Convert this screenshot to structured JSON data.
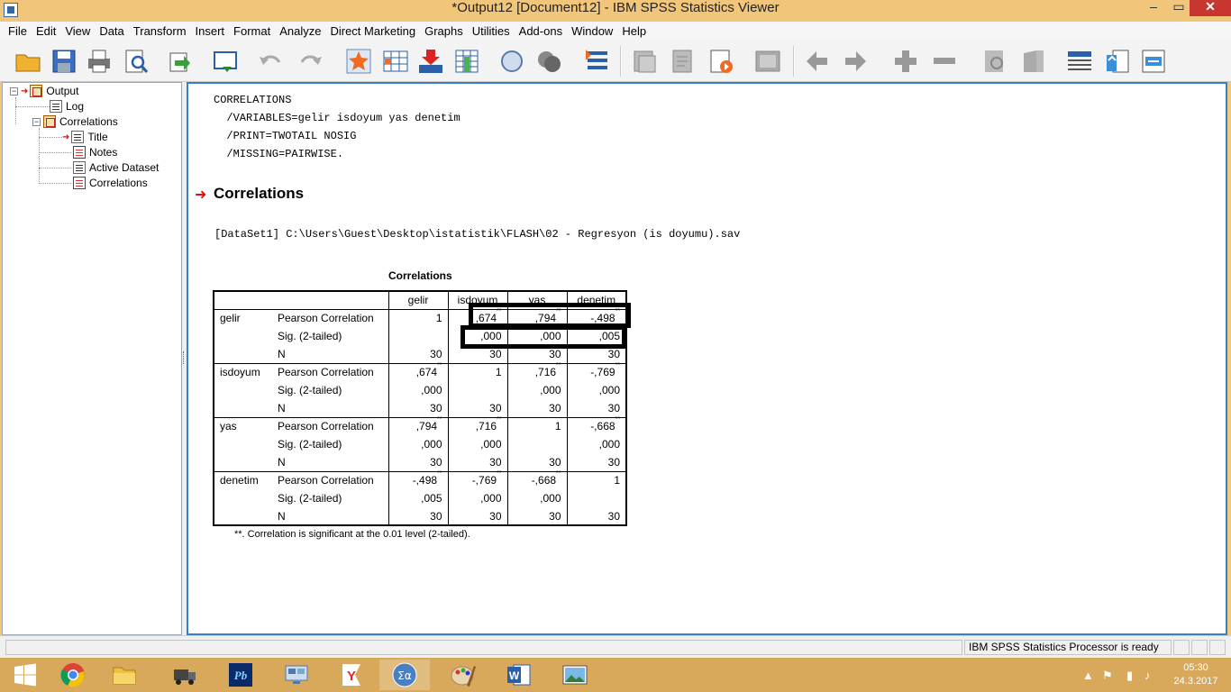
{
  "window": {
    "title": "*Output12 [Document12] - IBM SPSS Statistics Viewer",
    "minimize": "–",
    "maximize": "▭",
    "close": "✕"
  },
  "menu": [
    "File",
    "Edit",
    "View",
    "Data",
    "Transform",
    "Insert",
    "Format",
    "Analyze",
    "Direct Marketing",
    "Graphs",
    "Utilities",
    "Add-ons",
    "Window",
    "Help"
  ],
  "toolbar_icons": [
    "open-icon",
    "save-icon",
    "print-icon",
    "print-preview-icon",
    "export-icon",
    "recall-dialog-icon",
    "undo-icon",
    "redo-icon",
    "goto-data-icon",
    "goto-case-icon",
    "goto-variable-icon",
    "variables-icon",
    "designate-window-icon",
    "run-icon",
    "script-icon",
    "insert-output-icon",
    "promote-icon",
    "demote-icon",
    "expand-icon",
    "collapse-icon",
    "show-icon",
    "hide-icon",
    "insert-heading-icon",
    "insert-title-icon",
    "insert-text-icon"
  ],
  "navigator": {
    "output": "Output",
    "log": "Log",
    "correlations": "Correlations",
    "title": "Title",
    "notes": "Notes",
    "active_dataset": "Active Dataset",
    "correlations_table": "Correlations"
  },
  "content": {
    "syntax": [
      "CORRELATIONS",
      "  /VARIABLES=gelir isdoyum yas denetim",
      "  /PRINT=TWOTAIL NOSIG",
      "  /MISSING=PAIRWISE."
    ],
    "section_title": "Correlations",
    "dataset_line": "[DataSet1] C:\\Users\\Guest\\Desktop\\istatistik\\FLASH\\02 - Regresyon (is doyumu).sav",
    "table_title": "Correlations",
    "sig_mark": "**",
    "columns": [
      "gelir",
      "isdoyum",
      "yas",
      "denetim"
    ],
    "stat_labels": [
      "Pearson Correlation",
      "Sig. (2-tailed)",
      "N"
    ],
    "rows": [
      {
        "var": "gelir",
        "pearson": [
          "1",
          ",674",
          ",794",
          "-,498"
        ],
        "sig": [
          "",
          ",000",
          ",000",
          ",005"
        ],
        "n": [
          "30",
          "30",
          "30",
          "30"
        ]
      },
      {
        "var": "isdoyum",
        "pearson": [
          ",674",
          "1",
          ",716",
          "-,769"
        ],
        "sig": [
          ",000",
          "",
          ",000",
          ",000"
        ],
        "n": [
          "30",
          "30",
          "30",
          "30"
        ]
      },
      {
        "var": "yas",
        "pearson": [
          ",794",
          ",716",
          "1",
          "-,668"
        ],
        "sig": [
          ",000",
          ",000",
          "",
          ",000"
        ],
        "n": [
          "30",
          "30",
          "30",
          "30"
        ]
      },
      {
        "var": "denetim",
        "pearson": [
          "-,498",
          "-,769",
          "-,668",
          "1"
        ],
        "sig": [
          ",005",
          ",000",
          ",000",
          ""
        ],
        "n": [
          "30",
          "30",
          "30",
          "30"
        ]
      }
    ],
    "footnote": "**. Correlation is significant at the 0.01 level (2-tailed)."
  },
  "status": {
    "processor": "IBM SPSS Statistics Processor is ready"
  },
  "taskbar": {
    "apps": [
      "start-icon",
      "chrome-icon",
      "file-explorer-icon",
      "truck-app-icon",
      "pb-app-icon",
      "network-app-icon",
      "yandex-icon",
      "spss-icon",
      "paint-icon",
      "word-icon",
      "photo-viewer-icon"
    ],
    "time": "05:30",
    "date": "24.3.2017"
  }
}
